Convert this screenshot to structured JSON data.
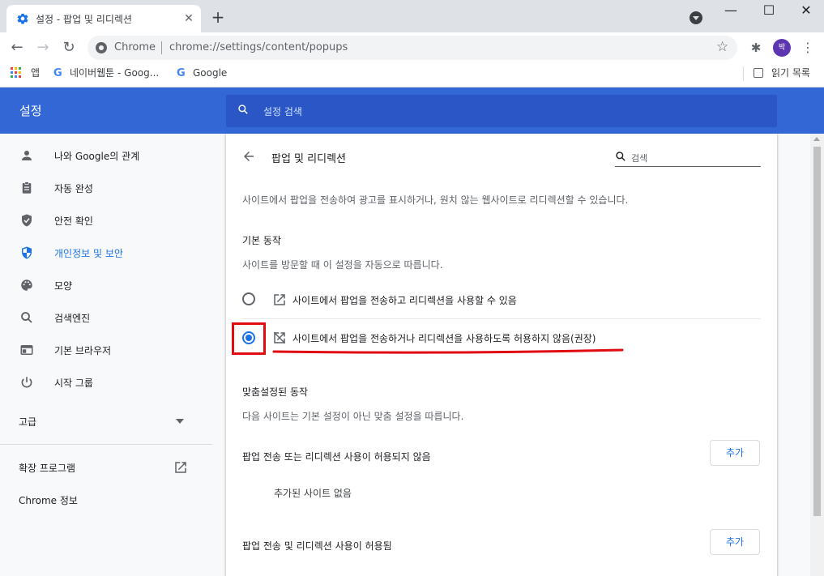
{
  "browser": {
    "tab": {
      "title": "설정 - 팝업 및 리디렉션",
      "icon": "gear-icon"
    },
    "new_tab_label": "+",
    "window_controls": {
      "minimize": "—",
      "maximize": "☐",
      "close": "✕"
    },
    "toolbar": {
      "back": "←",
      "forward": "→",
      "reload": "↻",
      "chip": "Chrome",
      "url": "chrome://settings/content/popups",
      "profile_initial": "박",
      "menu": "⋮"
    },
    "bookmarks": {
      "apps": "앱",
      "items": [
        {
          "label": "네이버웹툰 - Goog...",
          "icon": "google-icon"
        },
        {
          "label": "Google",
          "icon": "google-icon"
        }
      ],
      "reading_list": "읽기 목록"
    }
  },
  "settings": {
    "title": "설정",
    "search_placeholder": "설정 검색",
    "sidebar": {
      "items": [
        {
          "label": "나와 Google의 관계",
          "icon": "person-icon"
        },
        {
          "label": "자동 완성",
          "icon": "clipboard-icon"
        },
        {
          "label": "안전 확인",
          "icon": "shield-check-icon"
        },
        {
          "label": "개인정보 및 보안",
          "icon": "shield-icon",
          "active": true
        },
        {
          "label": "모양",
          "icon": "palette-icon"
        },
        {
          "label": "검색엔진",
          "icon": "search-icon"
        },
        {
          "label": "기본 브라우저",
          "icon": "browser-icon"
        },
        {
          "label": "시작 그룹",
          "icon": "power-icon"
        }
      ],
      "advanced": "고급",
      "extensions": "확장 프로그램",
      "about": "Chrome 정보"
    },
    "page": {
      "title": "팝업 및 리디렉션",
      "search_placeholder": "검색",
      "description": "사이트에서 팝업을 전송하여 광고를 표시하거나, 원치 않는 웹사이트로 리디렉션할 수 있습니다.",
      "default_behavior": {
        "heading": "기본 동작",
        "subheading": "사이트를 방문할 때 이 설정을 자동으로 따릅니다.",
        "options": [
          {
            "label": "사이트에서 팝업을 전송하고 리디렉션을 사용할 수 있음",
            "icon": "open-in-new-icon",
            "checked": false
          },
          {
            "label": "사이트에서 팝업을 전송하거나 리디렉션을 사용하도록 허용하지 않음(권장)",
            "icon": "popup-blocked-icon",
            "checked": true
          }
        ]
      },
      "custom_behavior": {
        "heading": "맞춤설정된 동작",
        "subheading": "다음 사이트는 기본 설정이 아닌 맞춤 설정을 따릅니다.",
        "blocked": {
          "label": "팝업 전송 또는 리디렉션 사용이 허용되지 않음",
          "add": "추가",
          "empty": "추가된 사이트 없음"
        },
        "allowed": {
          "label": "팝업 전송 및 리디렉션 사용이 허용됨",
          "add": "추가"
        }
      }
    }
  },
  "colors": {
    "header_blue": "#3367d6",
    "accent_blue": "#1a73e8",
    "annotation_red": "#e10b12"
  }
}
